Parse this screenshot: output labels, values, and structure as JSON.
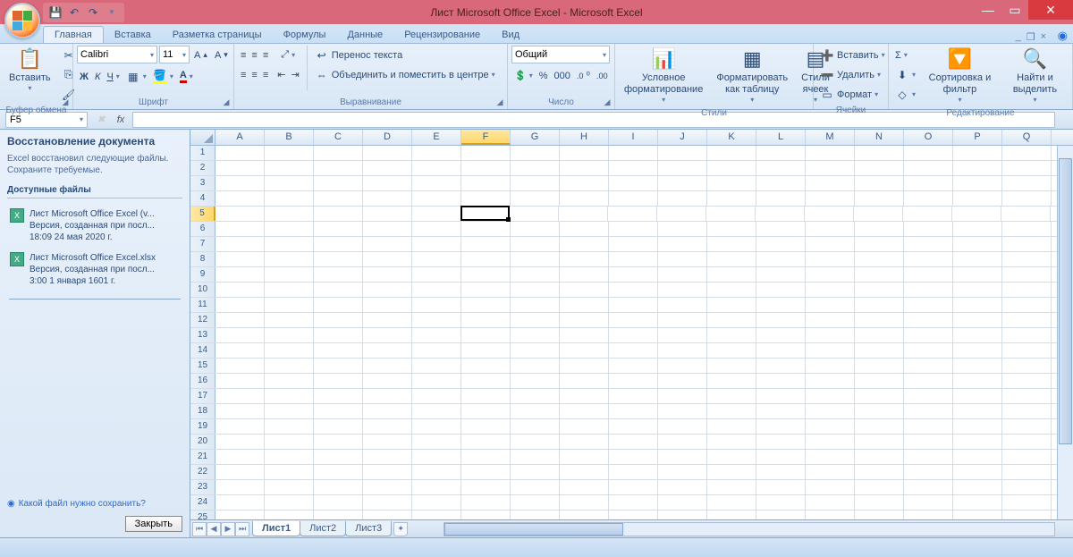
{
  "title": "Лист Microsoft Office Excel - Microsoft Excel",
  "tabs": [
    "Главная",
    "Вставка",
    "Разметка страницы",
    "Формулы",
    "Данные",
    "Рецензирование",
    "Вид"
  ],
  "activeTab": 0,
  "clipboard": {
    "paste": "Вставить",
    "label": "Буфер обмена"
  },
  "font": {
    "name": "Calibri",
    "size": "11",
    "bold": "Ж",
    "italic": "К",
    "underline": "Ч",
    "label": "Шрифт"
  },
  "align": {
    "wrap": "Перенос текста",
    "merge": "Объединить и поместить в центре",
    "label": "Выравнивание"
  },
  "number": {
    "format": "Общий",
    "label": "Число"
  },
  "styles": {
    "cond": "Условное форматирование",
    "table": "Форматировать как таблицу",
    "cell": "Стили ячеек",
    "label": "Стили"
  },
  "cells": {
    "insert": "Вставить",
    "delete": "Удалить",
    "format": "Формат",
    "label": "Ячейки"
  },
  "edit": {
    "sort": "Сортировка и фильтр",
    "find": "Найти и выделить",
    "label": "Редактирование"
  },
  "nameBox": "F5",
  "activeCell": {
    "col": "F",
    "row": 5
  },
  "cols": [
    "A",
    "B",
    "C",
    "D",
    "E",
    "F",
    "G",
    "H",
    "I",
    "J",
    "K",
    "L",
    "M",
    "N",
    "O",
    "P",
    "Q"
  ],
  "rowCount": 25,
  "sheets": [
    "Лист1",
    "Лист2",
    "Лист3"
  ],
  "activeSheet": 0,
  "recovery": {
    "title": "Восстановление документа",
    "sub": "Excel восстановил следующие файлы. Сохраните требуемые.",
    "avail": "Доступные файлы",
    "items": [
      {
        "name": "Лист Microsoft Office Excel (v...",
        "meta": "Версия, созданная при посл...",
        "time": "18:09 24 мая 2020 г."
      },
      {
        "name": "Лист Microsoft Office Excel.xlsx",
        "meta": "Версия, созданная при посл...",
        "time": "3:00 1 января 1601 г."
      }
    ],
    "question": "Какой файл нужно сохранить?",
    "close": "Закрыть"
  }
}
